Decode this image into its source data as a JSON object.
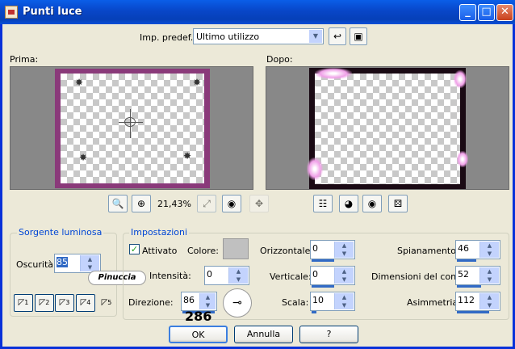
{
  "window": {
    "title": "Punti luce"
  },
  "preset": {
    "label": "Imp. predef.:",
    "value": "Ultimo utilizzo"
  },
  "prima": {
    "label": "Prima:"
  },
  "dopo": {
    "label": "Dopo:"
  },
  "zoom": {
    "value": "21,43%"
  },
  "sorgente": {
    "legend": "Sorgente luminosa",
    "oscurita_label": "Oscurità:",
    "oscurita_value": "85"
  },
  "watermark": {
    "text": "Pinuccia"
  },
  "impostazioni": {
    "legend": "Impostazioni",
    "attivato_label": "Attivato",
    "colore_label": "Colore:",
    "intensita_label": "Intensità:",
    "intensita_value": "0",
    "direzione_label": "Direzione:",
    "direzione_value": "86",
    "orizzontale_label": "Orizzontale:",
    "orizzontale_value": "0",
    "verticale_label": "Verticale:",
    "verticale_value": "0",
    "scala_label": "Scala:",
    "scala_value": "10",
    "spianamento_label": "Spianamento:",
    "spianamento_value": "46",
    "dimensioni_label": "Dimensioni del cono:",
    "dimensioni_value": "52",
    "asimmetria_label": "Asimmetria:",
    "asimmetria_value": "112"
  },
  "annotation": {
    "text": "286"
  },
  "buttons": {
    "ok": "OK",
    "annulla": "Annulla",
    "help": "?"
  },
  "presets": [
    "1",
    "2",
    "3",
    "4",
    "5"
  ],
  "colors": {
    "title_bar": "#0846c8",
    "frame_prima": "#8a3a7a",
    "dopo_border": "#1a0a14",
    "accent_text": "#0046d5"
  }
}
